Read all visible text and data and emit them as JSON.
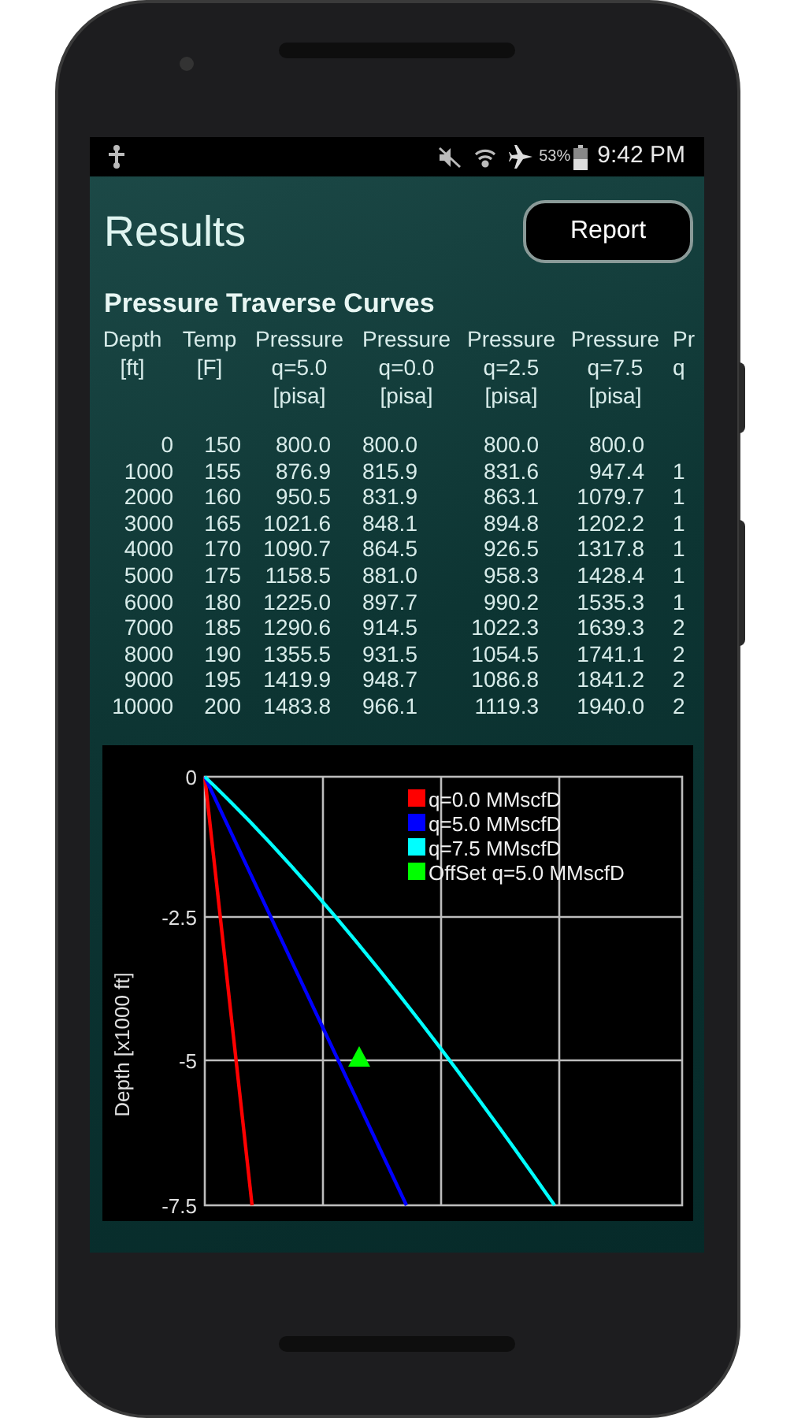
{
  "status_bar": {
    "battery": "53%",
    "time": "9:42 PM"
  },
  "header": {
    "title": "Results",
    "report_button": "Report"
  },
  "section_title": "Pressure Traverse Curves",
  "table": {
    "columns": [
      {
        "lines": [
          "Depth",
          "[ft]"
        ]
      },
      {
        "lines": [
          "Temp",
          "[F]"
        ]
      },
      {
        "lines": [
          "Pressure",
          "q=5.0",
          "[pisa]"
        ]
      },
      {
        "lines": [
          "Pressure",
          "q=0.0",
          "[pisa]"
        ]
      },
      {
        "lines": [
          "Pressure",
          "q=2.5",
          "[pisa]"
        ]
      },
      {
        "lines": [
          "Pressure",
          "q=7.5",
          "[pisa]"
        ]
      },
      {
        "lines": [
          "Pr",
          "q"
        ]
      }
    ],
    "rows": [
      [
        "0",
        "150",
        "800.0",
        "800.0",
        "800.0",
        "800.0"
      ],
      [
        "1000",
        "155",
        "876.9",
        "815.9",
        "831.6",
        "947.4",
        "1"
      ],
      [
        "2000",
        "160",
        "950.5",
        "831.9",
        "863.1",
        "1079.7",
        "1"
      ],
      [
        "3000",
        "165",
        "1021.6",
        "848.1",
        "894.8",
        "1202.2",
        "1"
      ],
      [
        "4000",
        "170",
        "1090.7",
        "864.5",
        "926.5",
        "1317.8",
        "1"
      ],
      [
        "5000",
        "175",
        "1158.5",
        "881.0",
        "958.3",
        "1428.4",
        "1"
      ],
      [
        "6000",
        "180",
        "1225.0",
        "897.7",
        "990.2",
        "1535.3",
        "1"
      ],
      [
        "7000",
        "185",
        "1290.6",
        "914.5",
        "1022.3",
        "1639.3",
        "2"
      ],
      [
        "8000",
        "190",
        "1355.5",
        "931.5",
        "1054.5",
        "1741.1",
        "2"
      ],
      [
        "9000",
        "195",
        "1419.9",
        "948.7",
        "1086.8",
        "1841.2",
        "2"
      ],
      [
        "10000",
        "200",
        "1483.8",
        "966.1",
        "1119.3",
        "1940.0",
        "2"
      ]
    ]
  },
  "chart": {
    "axis_title": "Depth [x1000 ft]",
    "tick_labels": [
      "0",
      "-2.5",
      "-5",
      "-7.5"
    ],
    "legend": [
      {
        "label": "q=0.0 MMscfD",
        "color": "#ff0000",
        "kind": "line"
      },
      {
        "label": "q=5.0 MMscfD",
        "color": "#0000ff",
        "kind": "line"
      },
      {
        "label": "q=7.5 MMscfD",
        "color": "#00ffff",
        "kind": "line"
      },
      {
        "label": "OffSet q=5.0 MMscfD",
        "color": "#00ff00",
        "kind": "marker"
      }
    ]
  }
}
